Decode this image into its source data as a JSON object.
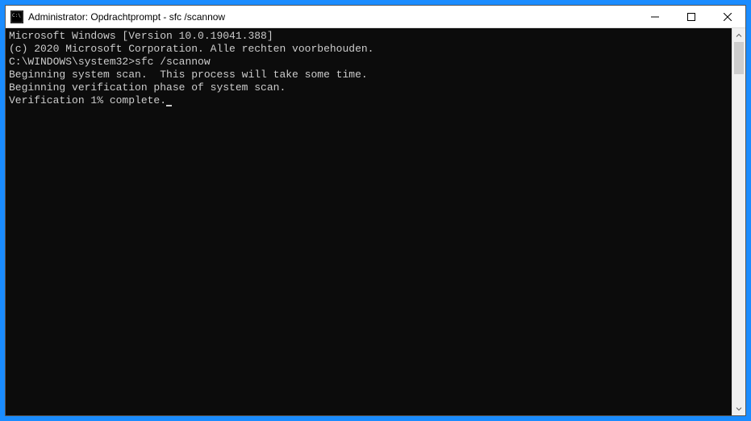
{
  "window": {
    "title": "Administrator: Opdrachtprompt - sfc  /scannow"
  },
  "terminal": {
    "line1": "Microsoft Windows [Version 10.0.19041.388]",
    "line2": "(c) 2020 Microsoft Corporation. Alle rechten voorbehouden.",
    "blank1": "",
    "prompt": "C:\\WINDOWS\\system32>",
    "command": "sfc /scannow",
    "blank2": "",
    "line3": "Beginning system scan.  This process will take some time.",
    "blank3": "",
    "line4": "Beginning verification phase of system scan.",
    "line5": "Verification 1% complete."
  }
}
